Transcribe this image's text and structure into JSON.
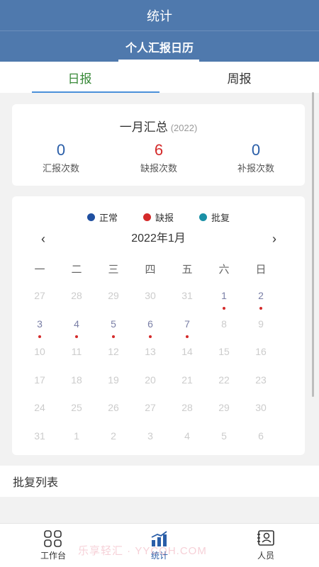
{
  "header": {
    "title": "统计"
  },
  "subheader": {
    "title": "个人汇报日历"
  },
  "tabs": [
    {
      "label": "日报",
      "active": true
    },
    {
      "label": "周报",
      "active": false
    }
  ],
  "summary": {
    "title": "一月汇总",
    "year": "(2022)",
    "stats": [
      {
        "value": "0",
        "label": "汇报次数",
        "color": "#2a5ea8"
      },
      {
        "value": "6",
        "label": "缺报次数",
        "color": "#d42a2a"
      },
      {
        "value": "0",
        "label": "补报次数",
        "color": "#2a5ea8"
      }
    ]
  },
  "calendar": {
    "legend": [
      {
        "label": "正常",
        "color": "#1f4fa0"
      },
      {
        "label": "缺报",
        "color": "#d42a2a"
      },
      {
        "label": "批复",
        "color": "#1a90a6"
      }
    ],
    "prev_icon": "‹",
    "next_icon": "›",
    "month_label": "2022年1月",
    "weekdays": [
      "一",
      "二",
      "三",
      "四",
      "五",
      "六",
      "日"
    ],
    "weeks": [
      [
        {
          "d": "27",
          "in": false
        },
        {
          "d": "28",
          "in": false
        },
        {
          "d": "29",
          "in": false
        },
        {
          "d": "30",
          "in": false
        },
        {
          "d": "31",
          "in": false
        },
        {
          "d": "1",
          "in": true,
          "mark": true
        },
        {
          "d": "2",
          "in": true,
          "mark": true
        }
      ],
      [
        {
          "d": "3",
          "in": true,
          "mark": true
        },
        {
          "d": "4",
          "in": true,
          "mark": true
        },
        {
          "d": "5",
          "in": true,
          "mark": true
        },
        {
          "d": "6",
          "in": true,
          "mark": true
        },
        {
          "d": "7",
          "in": true,
          "mark": true
        },
        {
          "d": "8",
          "in": false
        },
        {
          "d": "9",
          "in": false
        }
      ],
      [
        {
          "d": "10",
          "in": false
        },
        {
          "d": "11",
          "in": false
        },
        {
          "d": "12",
          "in": false
        },
        {
          "d": "13",
          "in": false
        },
        {
          "d": "14",
          "in": false
        },
        {
          "d": "15",
          "in": false
        },
        {
          "d": "16",
          "in": false
        }
      ],
      [
        {
          "d": "17",
          "in": false
        },
        {
          "d": "18",
          "in": false
        },
        {
          "d": "19",
          "in": false
        },
        {
          "d": "20",
          "in": false
        },
        {
          "d": "21",
          "in": false
        },
        {
          "d": "22",
          "in": false
        },
        {
          "d": "23",
          "in": false
        }
      ],
      [
        {
          "d": "24",
          "in": false
        },
        {
          "d": "25",
          "in": false
        },
        {
          "d": "26",
          "in": false
        },
        {
          "d": "27",
          "in": false
        },
        {
          "d": "28",
          "in": false
        },
        {
          "d": "29",
          "in": false
        },
        {
          "d": "30",
          "in": false
        }
      ],
      [
        {
          "d": "31",
          "in": false
        },
        {
          "d": "1",
          "in": false
        },
        {
          "d": "2",
          "in": false
        },
        {
          "d": "3",
          "in": false
        },
        {
          "d": "4",
          "in": false
        },
        {
          "d": "5",
          "in": false
        },
        {
          "d": "6",
          "in": false
        }
      ]
    ]
  },
  "reply_list": {
    "title": "批复列表"
  },
  "bottom_nav": [
    {
      "label": "工作台",
      "icon": "grid-icon",
      "active": false
    },
    {
      "label": "统计",
      "icon": "chart-icon",
      "active": true
    },
    {
      "label": "人员",
      "icon": "person-card-icon",
      "active": false
    }
  ],
  "watermark": "乐享轻汇 · YYCQH.COM"
}
